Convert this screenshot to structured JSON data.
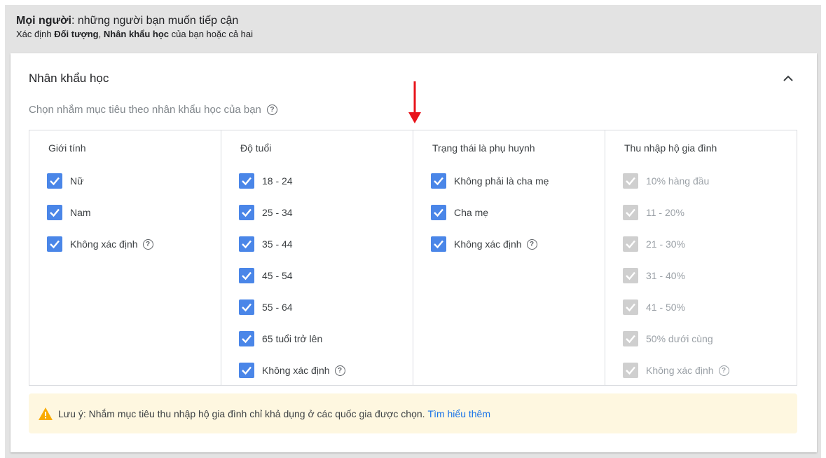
{
  "header": {
    "title_bold": "Mọi người",
    "title_rest": ": những người bạn muốn tiếp cận",
    "sub_prefix": "Xác định ",
    "sub_bold1": "Đối tượng",
    "sub_sep": ", ",
    "sub_bold2": "Nhân khẩu học",
    "sub_suffix": " của bạn hoặc cả hai"
  },
  "section": {
    "title": "Nhân khẩu học",
    "subtitle": "Chọn nhắm mục tiêu theo nhân khẩu học của bạn"
  },
  "columns": [
    {
      "title": "Giới tính",
      "options": [
        {
          "label": "Nữ",
          "checked": true
        },
        {
          "label": "Nam",
          "checked": true
        },
        {
          "label": "Không xác định",
          "checked": true,
          "help": true
        }
      ]
    },
    {
      "title": "Độ tuổi",
      "options": [
        {
          "label": "18 - 24",
          "checked": true
        },
        {
          "label": "25 - 34",
          "checked": true
        },
        {
          "label": "35 - 44",
          "checked": true
        },
        {
          "label": "45 - 54",
          "checked": true
        },
        {
          "label": "55 - 64",
          "checked": true
        },
        {
          "label": "65 tuổi trở lên",
          "checked": true
        },
        {
          "label": "Không xác định",
          "checked": true,
          "help": true
        }
      ]
    },
    {
      "title": "Trạng thái là phụ huynh",
      "options": [
        {
          "label": "Không phải là cha mẹ",
          "checked": true
        },
        {
          "label": "Cha mẹ",
          "checked": true
        },
        {
          "label": "Không xác định",
          "checked": true,
          "help": true
        }
      ]
    },
    {
      "title": "Thu nhập hộ gia đình",
      "options": [
        {
          "label": "10% hàng đầu",
          "checked": true,
          "disabled": true
        },
        {
          "label": "11 - 20%",
          "checked": true,
          "disabled": true
        },
        {
          "label": "21 - 30%",
          "checked": true,
          "disabled": true
        },
        {
          "label": "31 - 40%",
          "checked": true,
          "disabled": true
        },
        {
          "label": "41 - 50%",
          "checked": true,
          "disabled": true
        },
        {
          "label": "50% dưới cùng",
          "checked": true,
          "disabled": true
        },
        {
          "label": "Không xác định",
          "checked": true,
          "disabled": true,
          "help": true
        }
      ]
    }
  ],
  "note": {
    "text": "Lưu ý: Nhắm mục tiêu thu nhập hộ gia đình chỉ khả dụng ở các quốc gia được chọn.",
    "link": "Tìm hiểu thêm"
  },
  "icons": {
    "help": "?",
    "collapse": "chevron-up-icon",
    "warning": "warning-triangle-icon",
    "annotation": "red-down-arrow"
  },
  "colors": {
    "checkbox_checked": "#4a86e8",
    "checkbox_disabled": "#cfcfcf",
    "note_bg": "#fef7e0",
    "link": "#1a73e8",
    "warning": "#f9ab00",
    "annotation_arrow": "#e8141b"
  }
}
